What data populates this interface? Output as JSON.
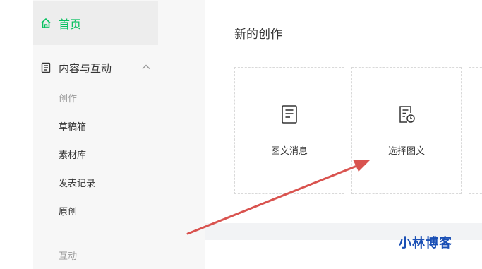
{
  "sidebar": {
    "home_label": "首页",
    "group_label": "内容与互动",
    "items": [
      {
        "label": "创作"
      },
      {
        "label": "草稿箱"
      },
      {
        "label": "素材库"
      },
      {
        "label": "发表记录"
      },
      {
        "label": "原创"
      }
    ],
    "section_label": "互动"
  },
  "main": {
    "title": "新的创作",
    "cards": [
      {
        "label": "图文消息",
        "icon": "document-icon"
      },
      {
        "label": "选择图文",
        "icon": "document-clock-icon"
      }
    ]
  },
  "annotation": {
    "watermark": "小林博客",
    "arrow_color": "#d9534f"
  },
  "colors": {
    "accent": "#07c160",
    "sidebar_bg": "#f7f7f7",
    "active_bg": "#ededed",
    "watermark": "#1a4fb5"
  }
}
